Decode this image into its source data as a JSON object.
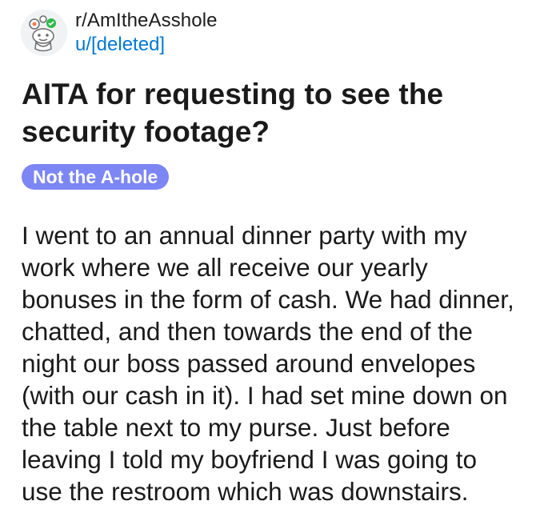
{
  "post": {
    "subreddit": "r/AmItheAsshole",
    "author": "u/[deleted]",
    "avatar_icon": "reddit-snoo-icon",
    "title": "AITA for requesting to see the\nsecurity footage?",
    "flair": "Not the A-hole",
    "flair_color": "#7c86f4",
    "body": "I went to an annual dinner party with my\nwork where we all receive our yearly\nbonuses in the form of cash. We had dinner,\nchatted, and then towards the end of the\nnight our boss passed around envelopes\n(with our cash in it). I had set mine down on\nthe table next to my purse. Just before\nleaving I told my boyfriend I was going to\nuse the restroom which was downstairs."
  }
}
